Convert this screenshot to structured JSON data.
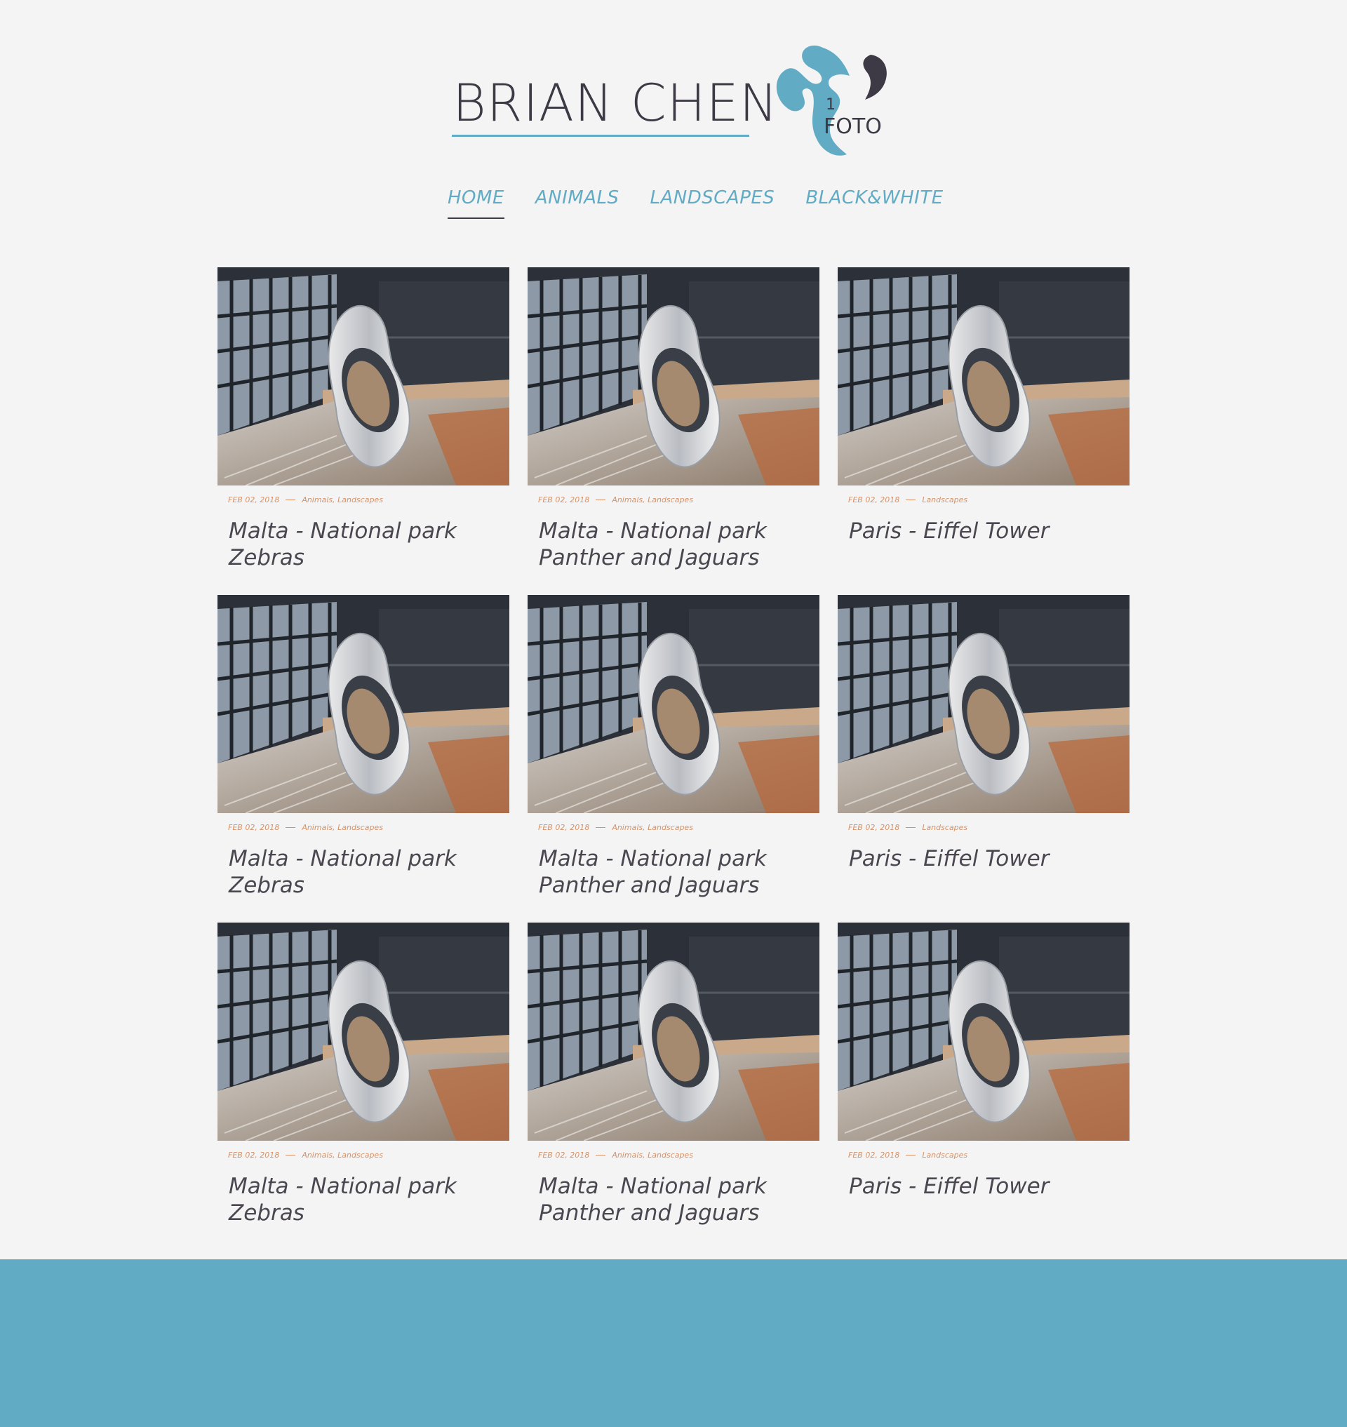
{
  "brand": {
    "name": "BRIAN CHEN",
    "logo_number": "1",
    "logo_text": "FOTO",
    "accent_color": "#61abc4",
    "dark_color": "#3d3a45"
  },
  "nav": {
    "items": [
      {
        "label": "HOME"
      },
      {
        "label": "ANIMALS"
      },
      {
        "label": "LANDSCAPES"
      },
      {
        "label": "BLACK&WHITE"
      }
    ]
  },
  "posts": [
    {
      "date": "FEB 02, 2018",
      "categories": "Animals, Landscapes",
      "title": "Malta - National park Zebras"
    },
    {
      "date": "FEB 02, 2018",
      "categories": "Animals, Landscapes",
      "title": "Malta - National park Panther and Jaguars"
    },
    {
      "date": "FEB 02, 2018",
      "categories": "Landscapes",
      "title": "Paris - Eiffel Tower"
    },
    {
      "date": "FEB 02, 2018",
      "categories": "Animals, Landscapes",
      "title": "Malta - National park Zebras"
    },
    {
      "date": "FEB 02, 2018",
      "categories": "Animals, Landscapes",
      "title": "Malta - National park Panther and Jaguars"
    },
    {
      "date": "FEB 02, 2018",
      "categories": "Landscapes",
      "title": "Paris - Eiffel Tower"
    },
    {
      "date": "FEB 02, 2018",
      "categories": "Animals, Landscapes",
      "title": "Malta - National park Zebras"
    },
    {
      "date": "FEB 02, 2018",
      "categories": "Animals, Landscapes",
      "title": "Malta - National park Panther and Jaguars"
    },
    {
      "date": "FEB 02, 2018",
      "categories": "Landscapes",
      "title": "Paris - Eiffel Tower"
    }
  ],
  "footer": {
    "color": "#61abc4"
  }
}
